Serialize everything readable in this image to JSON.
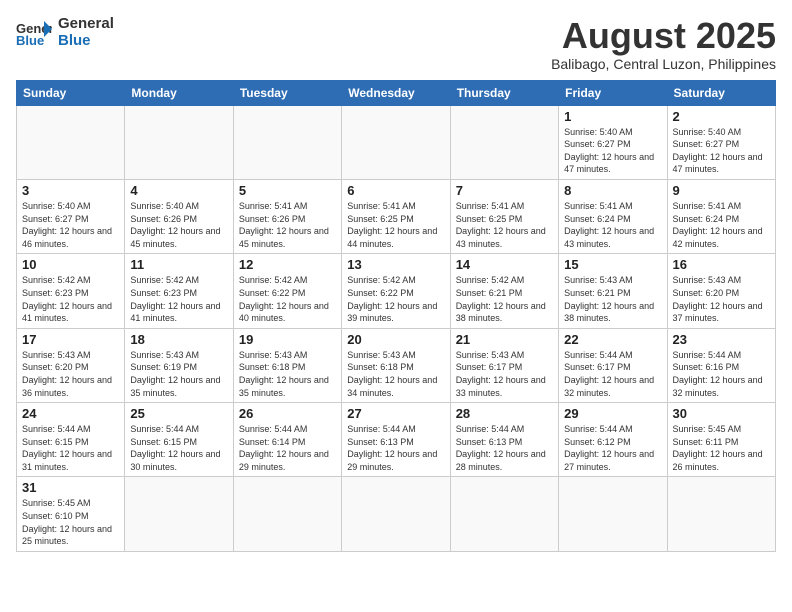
{
  "header": {
    "logo_general": "General",
    "logo_blue": "Blue",
    "title": "August 2025",
    "subtitle": "Balibago, Central Luzon, Philippines"
  },
  "days_of_week": [
    "Sunday",
    "Monday",
    "Tuesday",
    "Wednesday",
    "Thursday",
    "Friday",
    "Saturday"
  ],
  "weeks": [
    [
      {
        "day": "",
        "info": ""
      },
      {
        "day": "",
        "info": ""
      },
      {
        "day": "",
        "info": ""
      },
      {
        "day": "",
        "info": ""
      },
      {
        "day": "",
        "info": ""
      },
      {
        "day": "1",
        "info": "Sunrise: 5:40 AM\nSunset: 6:27 PM\nDaylight: 12 hours and 47 minutes."
      },
      {
        "day": "2",
        "info": "Sunrise: 5:40 AM\nSunset: 6:27 PM\nDaylight: 12 hours and 47 minutes."
      }
    ],
    [
      {
        "day": "3",
        "info": "Sunrise: 5:40 AM\nSunset: 6:27 PM\nDaylight: 12 hours and 46 minutes."
      },
      {
        "day": "4",
        "info": "Sunrise: 5:40 AM\nSunset: 6:26 PM\nDaylight: 12 hours and 45 minutes."
      },
      {
        "day": "5",
        "info": "Sunrise: 5:41 AM\nSunset: 6:26 PM\nDaylight: 12 hours and 45 minutes."
      },
      {
        "day": "6",
        "info": "Sunrise: 5:41 AM\nSunset: 6:25 PM\nDaylight: 12 hours and 44 minutes."
      },
      {
        "day": "7",
        "info": "Sunrise: 5:41 AM\nSunset: 6:25 PM\nDaylight: 12 hours and 43 minutes."
      },
      {
        "day": "8",
        "info": "Sunrise: 5:41 AM\nSunset: 6:24 PM\nDaylight: 12 hours and 43 minutes."
      },
      {
        "day": "9",
        "info": "Sunrise: 5:41 AM\nSunset: 6:24 PM\nDaylight: 12 hours and 42 minutes."
      }
    ],
    [
      {
        "day": "10",
        "info": "Sunrise: 5:42 AM\nSunset: 6:23 PM\nDaylight: 12 hours and 41 minutes."
      },
      {
        "day": "11",
        "info": "Sunrise: 5:42 AM\nSunset: 6:23 PM\nDaylight: 12 hours and 41 minutes."
      },
      {
        "day": "12",
        "info": "Sunrise: 5:42 AM\nSunset: 6:22 PM\nDaylight: 12 hours and 40 minutes."
      },
      {
        "day": "13",
        "info": "Sunrise: 5:42 AM\nSunset: 6:22 PM\nDaylight: 12 hours and 39 minutes."
      },
      {
        "day": "14",
        "info": "Sunrise: 5:42 AM\nSunset: 6:21 PM\nDaylight: 12 hours and 38 minutes."
      },
      {
        "day": "15",
        "info": "Sunrise: 5:43 AM\nSunset: 6:21 PM\nDaylight: 12 hours and 38 minutes."
      },
      {
        "day": "16",
        "info": "Sunrise: 5:43 AM\nSunset: 6:20 PM\nDaylight: 12 hours and 37 minutes."
      }
    ],
    [
      {
        "day": "17",
        "info": "Sunrise: 5:43 AM\nSunset: 6:20 PM\nDaylight: 12 hours and 36 minutes."
      },
      {
        "day": "18",
        "info": "Sunrise: 5:43 AM\nSunset: 6:19 PM\nDaylight: 12 hours and 35 minutes."
      },
      {
        "day": "19",
        "info": "Sunrise: 5:43 AM\nSunset: 6:18 PM\nDaylight: 12 hours and 35 minutes."
      },
      {
        "day": "20",
        "info": "Sunrise: 5:43 AM\nSunset: 6:18 PM\nDaylight: 12 hours and 34 minutes."
      },
      {
        "day": "21",
        "info": "Sunrise: 5:43 AM\nSunset: 6:17 PM\nDaylight: 12 hours and 33 minutes."
      },
      {
        "day": "22",
        "info": "Sunrise: 5:44 AM\nSunset: 6:17 PM\nDaylight: 12 hours and 32 minutes."
      },
      {
        "day": "23",
        "info": "Sunrise: 5:44 AM\nSunset: 6:16 PM\nDaylight: 12 hours and 32 minutes."
      }
    ],
    [
      {
        "day": "24",
        "info": "Sunrise: 5:44 AM\nSunset: 6:15 PM\nDaylight: 12 hours and 31 minutes."
      },
      {
        "day": "25",
        "info": "Sunrise: 5:44 AM\nSunset: 6:15 PM\nDaylight: 12 hours and 30 minutes."
      },
      {
        "day": "26",
        "info": "Sunrise: 5:44 AM\nSunset: 6:14 PM\nDaylight: 12 hours and 29 minutes."
      },
      {
        "day": "27",
        "info": "Sunrise: 5:44 AM\nSunset: 6:13 PM\nDaylight: 12 hours and 29 minutes."
      },
      {
        "day": "28",
        "info": "Sunrise: 5:44 AM\nSunset: 6:13 PM\nDaylight: 12 hours and 28 minutes."
      },
      {
        "day": "29",
        "info": "Sunrise: 5:44 AM\nSunset: 6:12 PM\nDaylight: 12 hours and 27 minutes."
      },
      {
        "day": "30",
        "info": "Sunrise: 5:45 AM\nSunset: 6:11 PM\nDaylight: 12 hours and 26 minutes."
      }
    ],
    [
      {
        "day": "31",
        "info": "Sunrise: 5:45 AM\nSunset: 6:10 PM\nDaylight: 12 hours and 25 minutes."
      },
      {
        "day": "",
        "info": ""
      },
      {
        "day": "",
        "info": ""
      },
      {
        "day": "",
        "info": ""
      },
      {
        "day": "",
        "info": ""
      },
      {
        "day": "",
        "info": ""
      },
      {
        "day": "",
        "info": ""
      }
    ]
  ]
}
